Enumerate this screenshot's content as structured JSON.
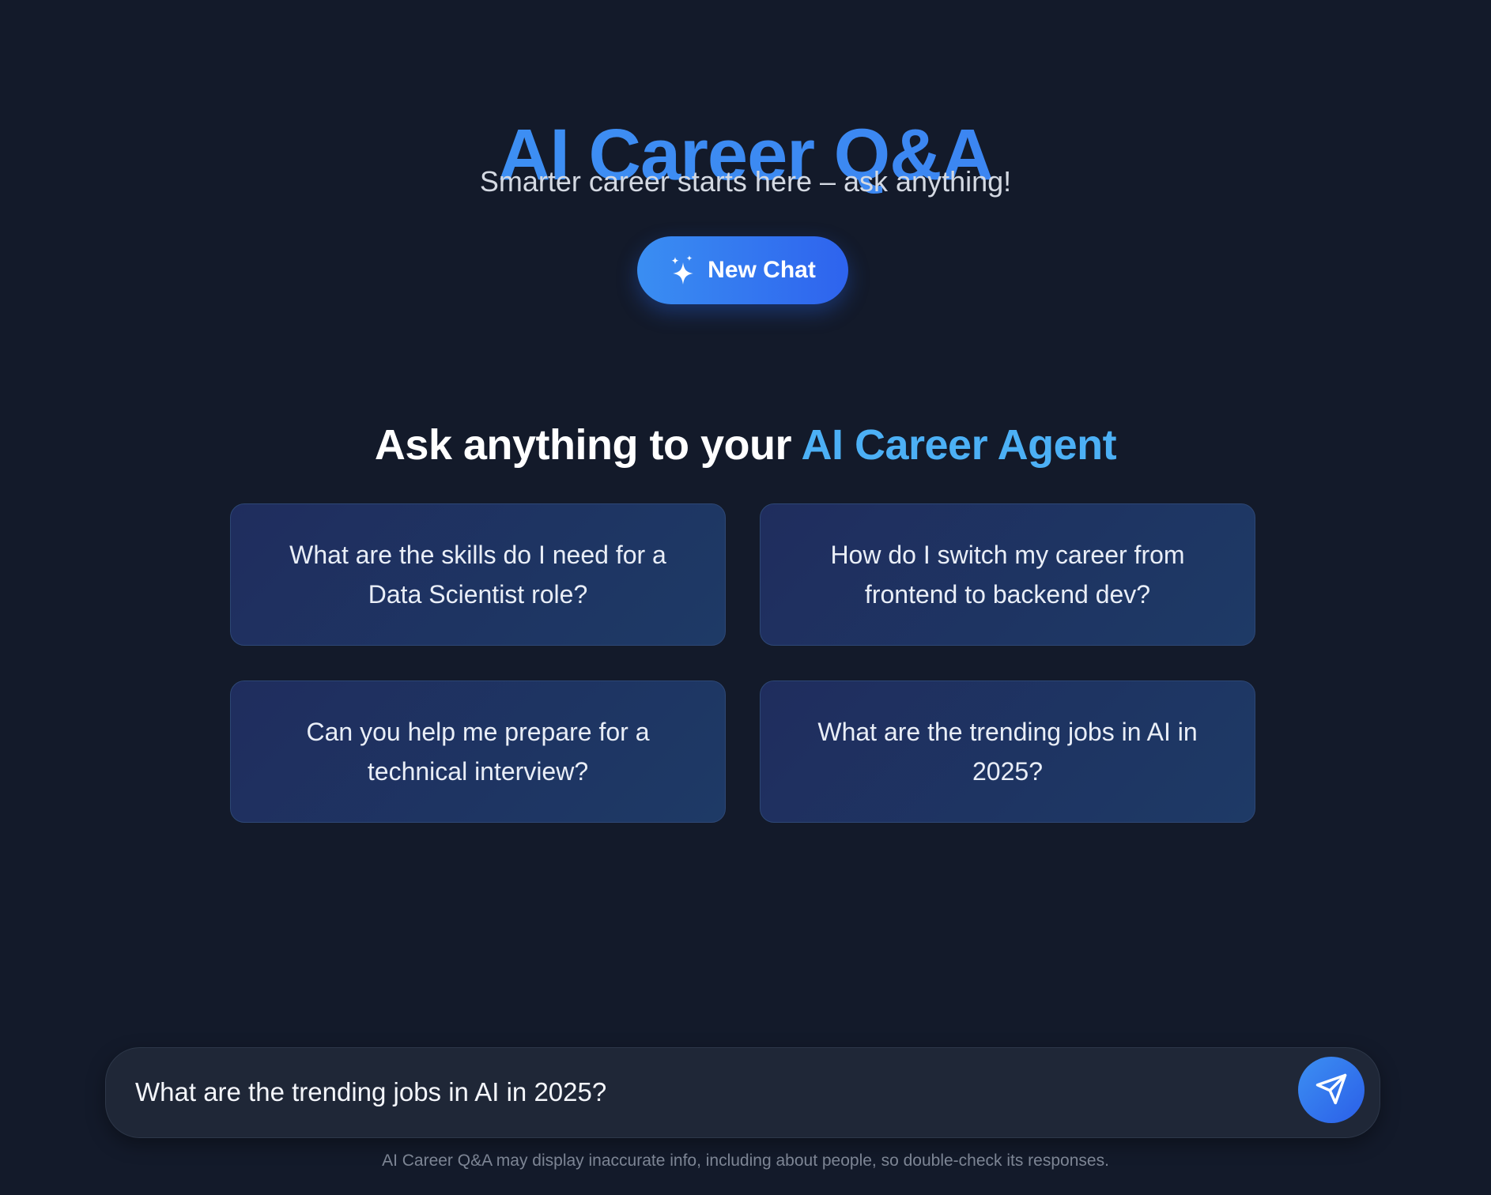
{
  "header": {
    "title": "AI Career Q&A",
    "tagline": "Smarter career starts here – ask anything!",
    "new_chat_label": "New Chat",
    "new_chat_icon": "sparkles-icon"
  },
  "intro": {
    "heading_prefix": "Ask anything to your ",
    "heading_accent": "AI Career Agent"
  },
  "suggestions": [
    {
      "text": "What are the skills do I need for a Data Scientist role?"
    },
    {
      "text": "How do I switch my career from frontend to backend dev?"
    },
    {
      "text": "Can you help me prepare for a technical interview?"
    },
    {
      "text": "What are the trending jobs in AI in 2025?"
    }
  ],
  "composer": {
    "value": "What are the trending jobs in AI in 2025?",
    "send_icon": "send-icon"
  },
  "footer": {
    "disclaimer": "AI Career Q&A may display inaccurate info, including about people, so double-check its responses."
  },
  "colors": {
    "background": "#131a2a",
    "accent_blue": "#3b8cf3",
    "accent_cyan": "#4cb0f5",
    "card_background": "#1f2d5e",
    "input_background": "#1f2737"
  }
}
